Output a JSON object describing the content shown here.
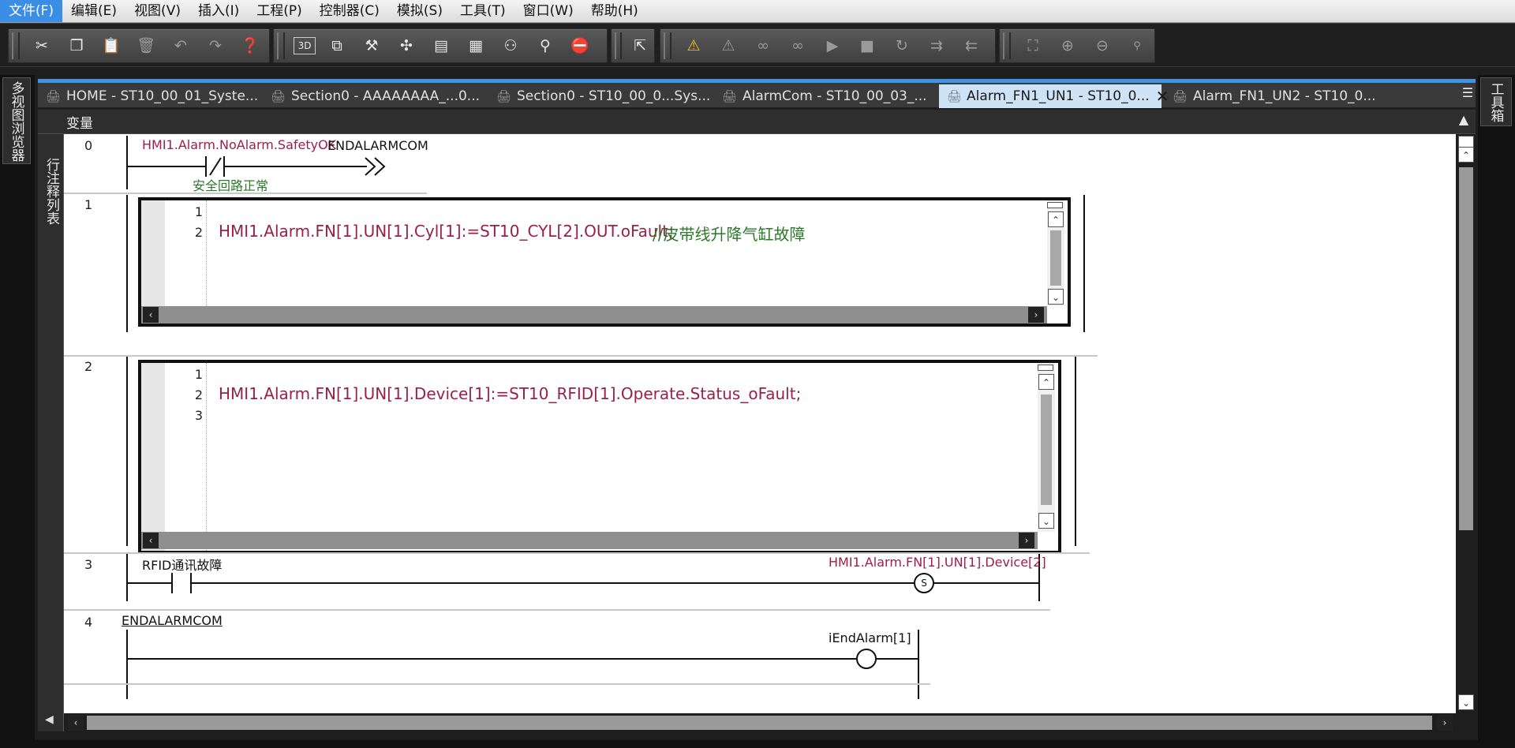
{
  "menu": [
    "文件(F)",
    "编辑(E)",
    "视图(V)",
    "插入(I)",
    "工程(P)",
    "控制器(C)",
    "模拟(S)",
    "工具(T)",
    "窗口(W)",
    "帮助(H)"
  ],
  "left_panel": {
    "label": "多视图浏览器"
  },
  "right_panel": {
    "label": "工具箱"
  },
  "tabs": [
    {
      "label": "HOME - ST10_00_01_Syste..."
    },
    {
      "label": "Section0 - AAAAAAAA_...0..."
    },
    {
      "label": "Section0 - ST10_00_0...Sys..."
    },
    {
      "label": "AlarmCom - ST10_00_03_..."
    },
    {
      "label": "Alarm_FN1_UN1 - ST10_0...",
      "active": true
    },
    {
      "label": "Alarm_FN1_UN2 - ST10_0..."
    }
  ],
  "variables_header": "变量",
  "row_comment_list": "行注释列表",
  "rungs": {
    "r0": {
      "num": "0",
      "contact_var": "HMI1.Alarm.NoAlarm.SafetyOK",
      "contact_comment": "安全回路正常",
      "jump_label": "ENDALARMCOM"
    },
    "r1": {
      "num": "1",
      "lines": [
        "1",
        "2"
      ],
      "code": "HMI1.Alarm.FN[1].UN[1].Cyl[1]:=ST10_CYL[2].OUT.oFault;",
      "comment": "//皮带线升降气缸故障"
    },
    "r2": {
      "num": "2",
      "lines": [
        "1",
        "2",
        "3"
      ],
      "code": "HMI1.Alarm.FN[1].UN[1].Device[1]:=ST10_RFID[1].Operate.Status_oFault;"
    },
    "r3": {
      "num": "3",
      "contact_var": "RFID通讯故障",
      "coil_var": "HMI1.Alarm.FN[1].UN[1].Device[2]",
      "coil_type": "S"
    },
    "r4": {
      "num": "4",
      "label": "ENDALARMCOM",
      "coil_var": "iEndAlarm[1]"
    }
  },
  "colors": {
    "accent": "#3e94e0",
    "variable": "#9b2046",
    "comment": "#2a7a2a"
  }
}
